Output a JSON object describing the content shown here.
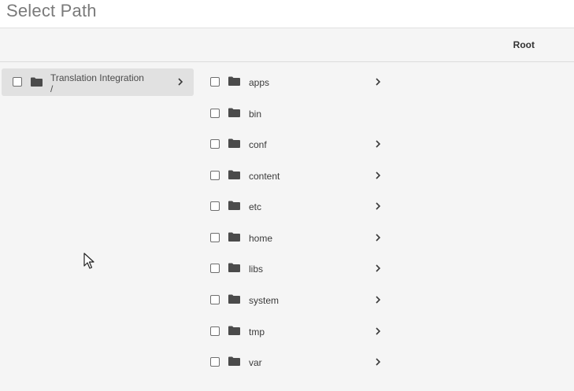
{
  "dialog": {
    "title": "Select Path"
  },
  "header": {
    "column_label": "Root"
  },
  "column1": {
    "label_line1": "Translation Integration",
    "label_line2": "/"
  },
  "column2": {
    "items": [
      {
        "label": "apps",
        "has_children": true
      },
      {
        "label": "bin",
        "has_children": false
      },
      {
        "label": "conf",
        "has_children": true
      },
      {
        "label": "content",
        "has_children": true
      },
      {
        "label": "etc",
        "has_children": true
      },
      {
        "label": "home",
        "has_children": true
      },
      {
        "label": "libs",
        "has_children": true
      },
      {
        "label": "system",
        "has_children": true
      },
      {
        "label": "tmp",
        "has_children": true
      },
      {
        "label": "var",
        "has_children": true
      }
    ]
  },
  "icons": {
    "folder": "folder-icon",
    "chevron": "chevron-right-icon",
    "checkbox": "checkbox",
    "cursor": "mouse-pointer-icon"
  },
  "colors": {
    "background": "#f5f5f5",
    "selected_row": "#e1e1e1",
    "title_text": "#7a7a7a",
    "icon": "#4b4b4b"
  }
}
